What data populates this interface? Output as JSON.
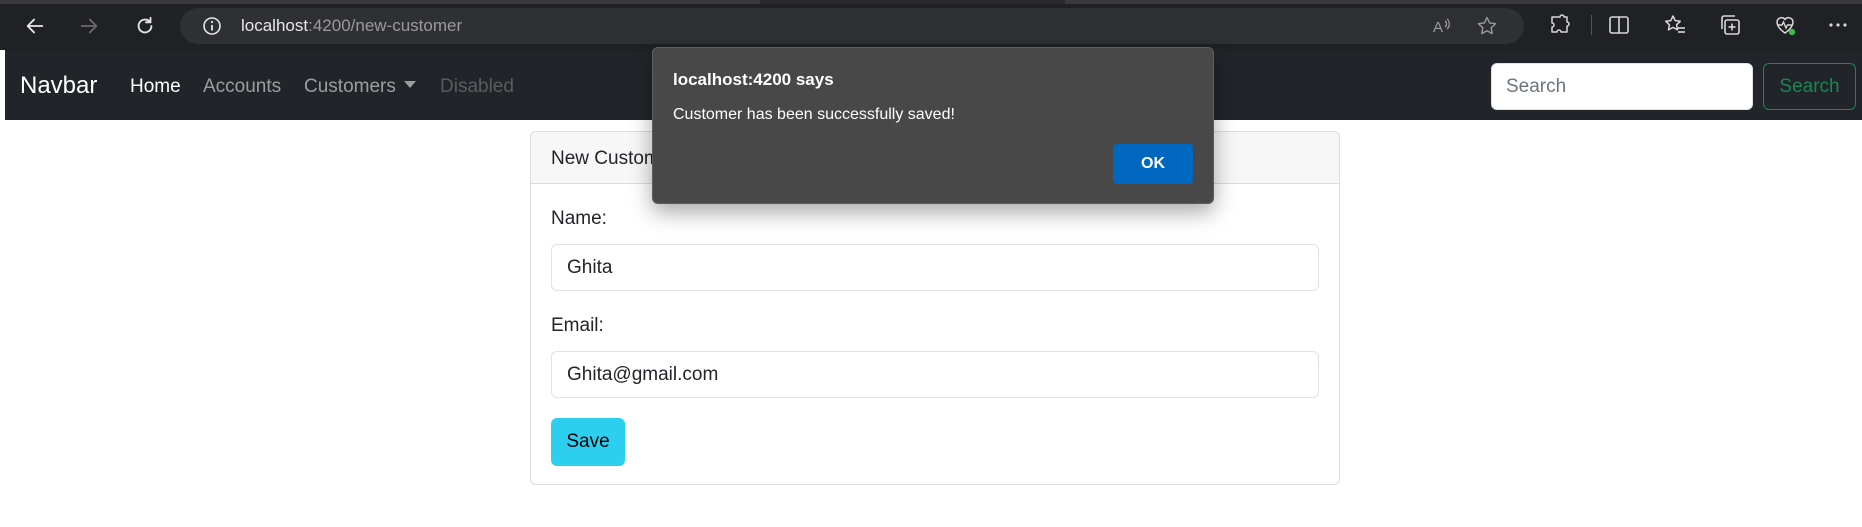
{
  "browser": {
    "url_host": "localhost",
    "url_path": ":4200/new-customer"
  },
  "navbar": {
    "brand": "Navbar",
    "links": [
      {
        "label": "Home",
        "state": "active"
      },
      {
        "label": "Accounts",
        "state": "normal"
      },
      {
        "label": "Customers",
        "state": "dropdown"
      },
      {
        "label": "Disabled",
        "state": "disabled"
      }
    ],
    "search_placeholder": "Search",
    "search_button": "Search"
  },
  "card": {
    "title": "New Customer",
    "name_label": "Name:",
    "name_value": "Ghita",
    "email_label": "Email:",
    "email_value": "Ghita@gmail.com",
    "save_label": "Save"
  },
  "dialog": {
    "title": "localhost:4200 says",
    "message": "Customer has been successfully saved!",
    "ok_label": "OK"
  },
  "colors": {
    "navbar_bg": "#212529",
    "save_button": "#2ccff0",
    "search_button": "#198754",
    "dialog_ok": "#0067c0"
  },
  "icons": {
    "browser": [
      "back-arrow-icon",
      "forward-arrow-icon",
      "refresh-icon",
      "info-icon",
      "read-aloud-icon",
      "favorite-star-icon",
      "extensions-icon",
      "split-screen-icon",
      "favorites-icon",
      "collections-icon",
      "browser-essentials-icon",
      "more-icon"
    ]
  }
}
